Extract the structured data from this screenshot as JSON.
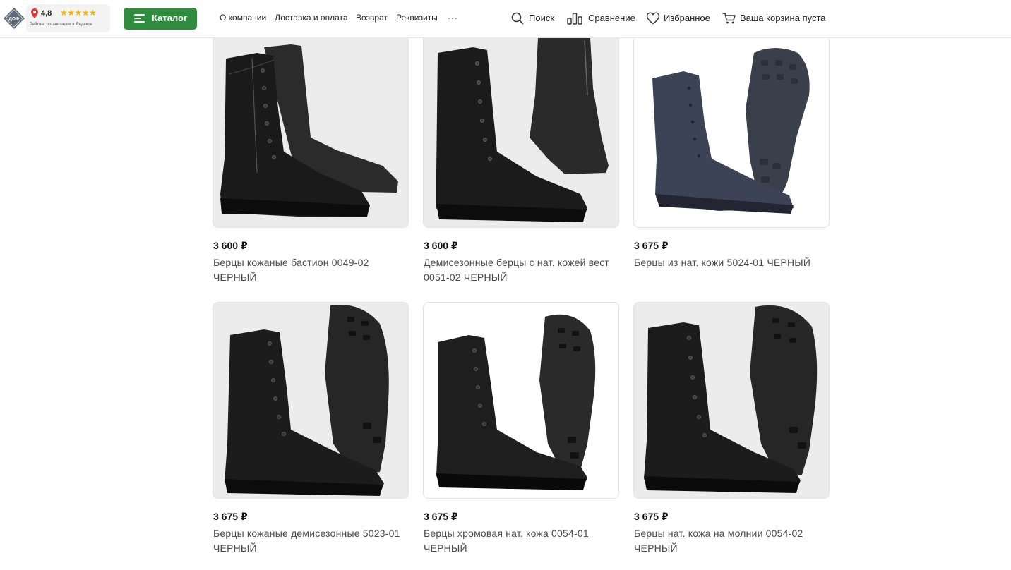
{
  "header": {
    "logo_text": "ДОФ",
    "rating_score": "4,8",
    "rating_stars": "★★★★★",
    "rating_caption": "Рейтинг организации в Яндексе",
    "catalog_label": "Каталог",
    "nav": [
      "О компании",
      "Доставка и оплата",
      "Возврат",
      "Реквизиты"
    ],
    "nav_more": "...",
    "search_label": "Поиск",
    "compare_label": "Сравнение",
    "favorites_label": "Избранное",
    "cart_label": "Ваша корзина пуста"
  },
  "colors": {
    "accent": "#2f8c3e",
    "star": "#f5b301",
    "pin": "#e53935"
  },
  "products": [
    {
      "price": "3 600 ₽",
      "name": "Берцы кожаные бастион 0049-02 ЧЕРНЫЙ"
    },
    {
      "price": "3 600 ₽",
      "name": "Демисезонные берцы с нат. кожей вест 0051-02 ЧЕРНЫЙ"
    },
    {
      "price": "3 675 ₽",
      "name": "Берцы из нат. кожи 5024-01 ЧЕРНЫЙ"
    },
    {
      "price": "3 675 ₽",
      "name": "Берцы кожаные демисезонные 5023-01 ЧЕРНЫЙ"
    },
    {
      "price": "3 675 ₽",
      "name": "Берцы хромовая нат. кожа 0054-01 ЧЕРНЫЙ"
    },
    {
      "price": "3 675 ₽",
      "name": "Берцы нат. кожа на молнии 0054-02 ЧЕРНЫЙ"
    }
  ]
}
